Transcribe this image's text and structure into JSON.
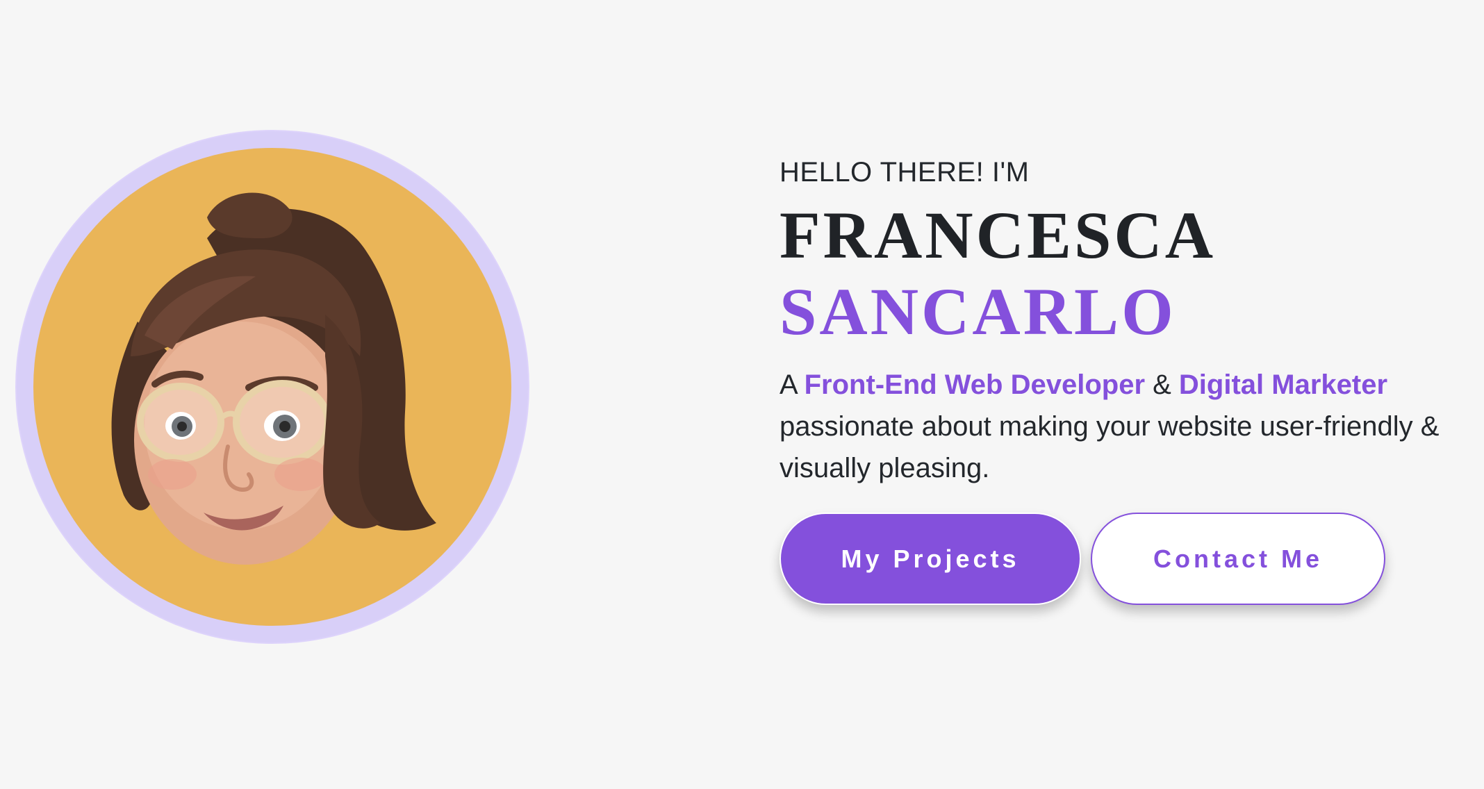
{
  "hero": {
    "greeting": "HELLO THERE! I'M",
    "first_name": "FRANCESCA",
    "last_name": "SANCARLO",
    "tagline": {
      "prefix": "A ",
      "role1": "Front-End Web Developer",
      "joiner": " & ",
      "role2": "Digital Marketer",
      "suffix": " passionate about making your website user-friendly & visually pleasing."
    },
    "buttons": {
      "projects": "My Projects",
      "contact": "Contact Me"
    },
    "avatar": {
      "icon": "memoji-avatar",
      "ring_color": "#d8cff8",
      "background_color": "#eab558"
    }
  },
  "colors": {
    "accent": "#8450dc",
    "text": "#22262b",
    "page_bg": "#f6f6f6"
  }
}
